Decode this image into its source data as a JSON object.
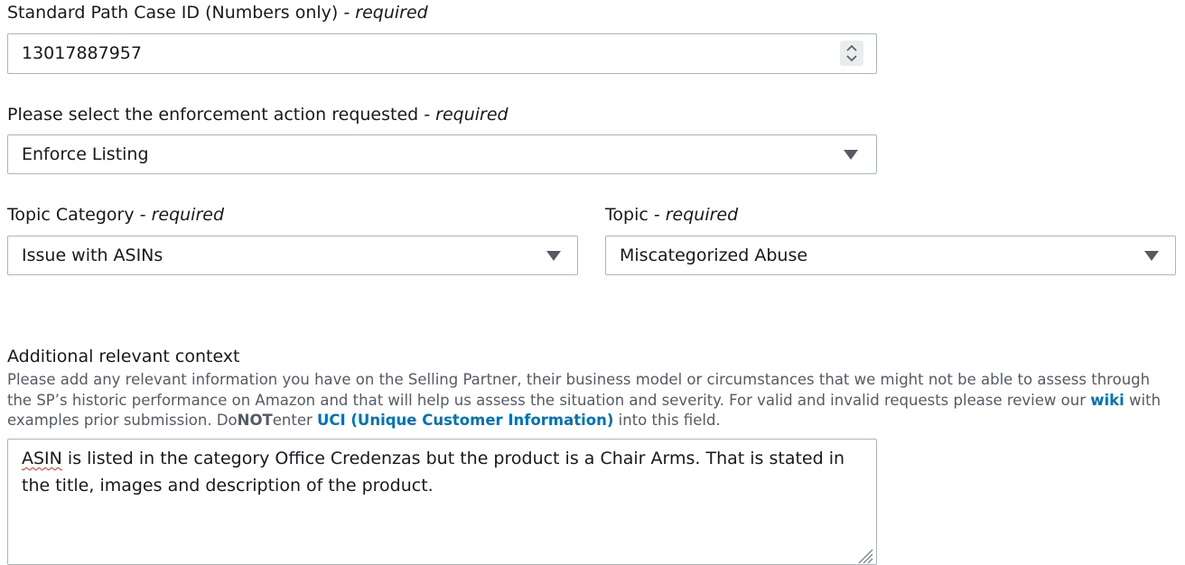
{
  "case_id": {
    "label": "Standard Path Case ID (Numbers only)",
    "required_suffix": "- required",
    "value": "13017887957"
  },
  "enforcement": {
    "label": "Please select the enforcement action requested",
    "required_suffix": "- required",
    "selected": "Enforce Listing"
  },
  "topic_category": {
    "label": "Topic Category",
    "required_suffix": "- required",
    "selected": "Issue with ASINs"
  },
  "topic": {
    "label": "Topic",
    "required_suffix": "- required",
    "selected": "Miscategorized Abuse"
  },
  "context": {
    "label": "Additional relevant context",
    "description_part1": "Please add any relevant information you have on the Selling Partner, their business model or circumstances that we might not be able to assess through the SP’s historic performance on Amazon and that will help us assess the situation and severity. For valid and invalid requests please review our",
    "wiki_link": "wiki",
    "description_part2": "with examples prior submission. Do",
    "not_text": "NOT",
    "description_part3": "enter",
    "uci_link": "UCI (Unique Customer Information)",
    "description_part4": "into this field.",
    "value_misspelled": "ASIN",
    "value_rest": " is  listed in the category Office Credenzas  but the product is a Chair Arms.  That is stated in the title, images and description of the product."
  },
  "icons": {
    "spinner": "up-down-spinner-icon",
    "dropdown": "caret-down-icon",
    "resize": "resize-grip-icon"
  },
  "colors": {
    "link": "#0073bb",
    "border": "#aab7b8",
    "help_text": "#545b64",
    "spell_error": "#d13212"
  }
}
